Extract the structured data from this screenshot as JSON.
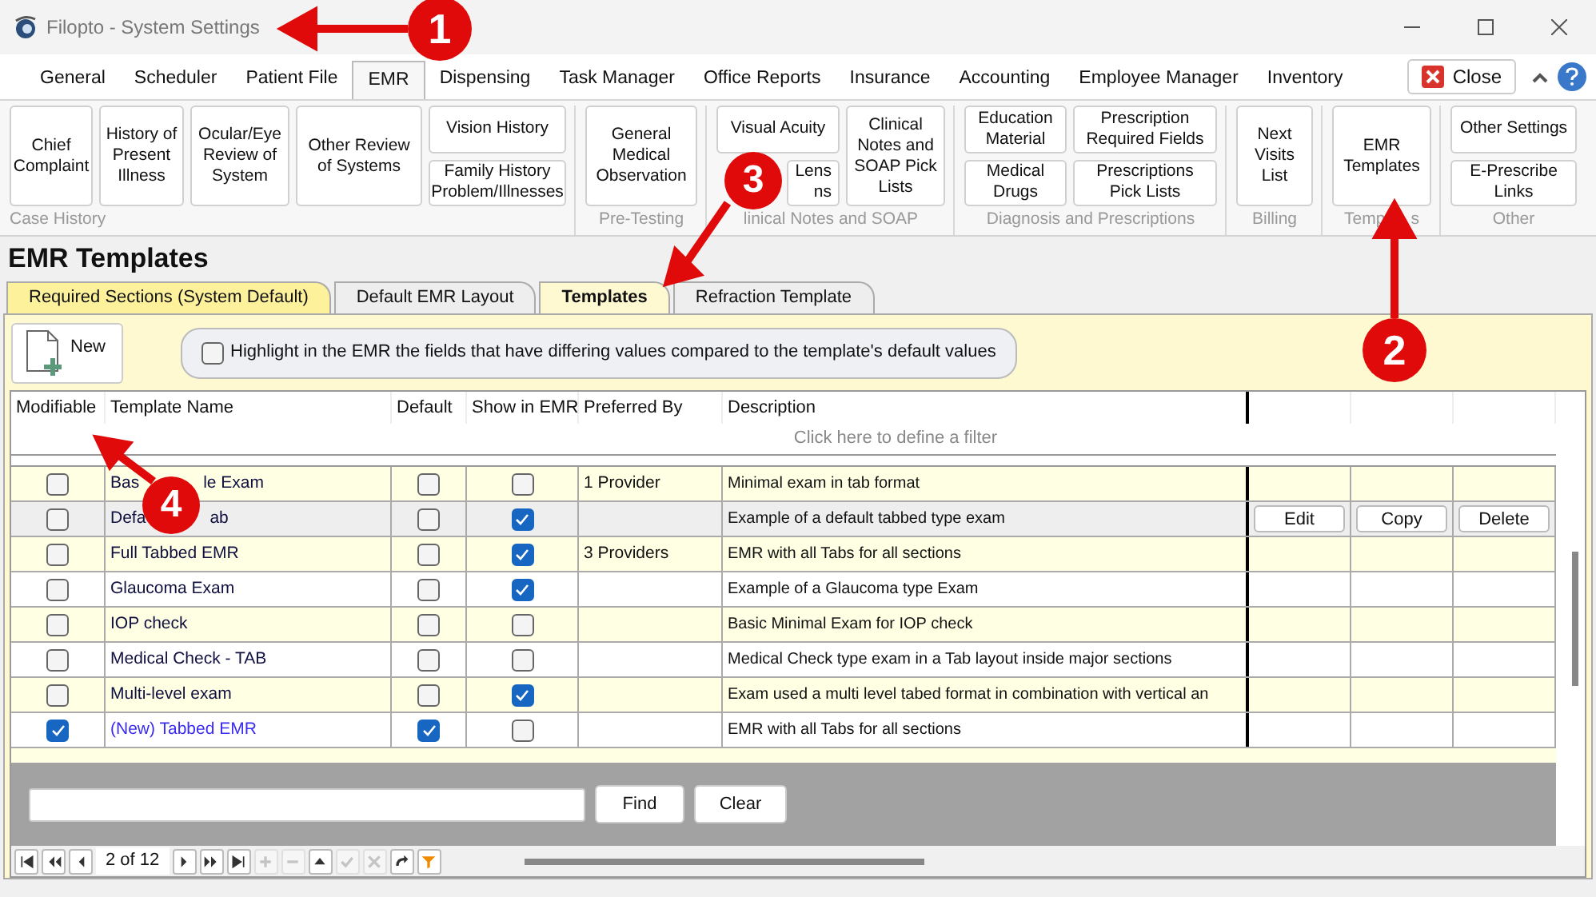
{
  "window": {
    "title": "Filopto - System Settings"
  },
  "menu_tabs": [
    {
      "label": "General",
      "selected": false
    },
    {
      "label": "Scheduler",
      "selected": false
    },
    {
      "label": "Patient File",
      "selected": false
    },
    {
      "label": "EMR",
      "selected": true
    },
    {
      "label": "Dispensing",
      "selected": false
    },
    {
      "label": "Task Manager",
      "selected": false
    },
    {
      "label": "Office Reports",
      "selected": false
    },
    {
      "label": "Insurance",
      "selected": false
    },
    {
      "label": "Accounting",
      "selected": false
    },
    {
      "label": "Employee Manager",
      "selected": false
    },
    {
      "label": "Inventory",
      "selected": false
    }
  ],
  "close_button": "Close",
  "ribbon": [
    {
      "label": [
        "Case History"
      ],
      "columns": [
        [
          {
            "lines": [
              "Chief",
              "Complaint"
            ]
          }
        ],
        [
          {
            "lines": [
              "History of",
              "Present",
              "Illness"
            ]
          }
        ],
        [
          {
            "lines": [
              "Ocular/Eye",
              "Review of",
              "System"
            ]
          }
        ],
        [
          {
            "lines": [
              "Other Review",
              "of Systems"
            ]
          }
        ],
        [
          {
            "lines": [
              "Vision History"
            ]
          },
          {
            "lines": [
              "Family History",
              "Problem/Illnesses"
            ]
          }
        ]
      ]
    },
    {
      "label": [
        "Pre-Testing"
      ],
      "columns": [
        [
          {
            "lines": [
              "General",
              "Medical",
              "Observation"
            ]
          }
        ]
      ]
    },
    {
      "label": [
        "linical Notes and SOAP"
      ],
      "columns": [
        [
          {
            "lines": [
              "Visual Acuity"
            ]
          },
          {
            "lines": [
              "Lens",
              "ns"
            ]
          }
        ],
        [
          {
            "lines": [
              "Clinical",
              "Notes and",
              "SOAP Pick",
              "Lists"
            ]
          }
        ]
      ]
    },
    {
      "label": [
        "Diagnosis and Prescriptions"
      ],
      "columns": [
        [
          {
            "lines": [
              "Education",
              "Material"
            ]
          },
          {
            "lines": [
              "Medical",
              "Drugs"
            ]
          }
        ],
        [
          {
            "lines": [
              "Prescription",
              "Required Fields"
            ]
          },
          {
            "lines": [
              "Prescriptions",
              "Pick Lists"
            ]
          }
        ]
      ]
    },
    {
      "label": [
        "Billing"
      ],
      "columns": [
        [
          {
            "lines": [
              "Next",
              "Visits",
              "List"
            ]
          }
        ]
      ]
    },
    {
      "label": [
        "Temp",
        "s"
      ],
      "columns": [
        [
          {
            "lines": [
              "EMR",
              "Templates"
            ]
          }
        ]
      ]
    },
    {
      "label": [
        "Other"
      ],
      "columns": [
        [
          {
            "lines": [
              "Other Settings"
            ]
          },
          {
            "lines": [
              "E-Prescribe",
              "Links"
            ]
          }
        ]
      ]
    }
  ],
  "page_title": "EMR Templates",
  "tabs": [
    {
      "label": "Required Sections (System Default)",
      "selected": false,
      "highlighted": true
    },
    {
      "label": "Default EMR Layout",
      "selected": false,
      "highlighted": false
    },
    {
      "label": "Templates",
      "selected": true,
      "highlighted": false
    },
    {
      "label": "Refraction Template",
      "selected": false,
      "highlighted": false
    }
  ],
  "new_button": "New",
  "highlight_option": {
    "label": "Highlight in the EMR the fields that have differing values compared to the template's default values",
    "checked": false
  },
  "table": {
    "columns": [
      "Modifiable",
      "Template Name",
      "Default",
      "Show in EMR",
      "Preferred By",
      "Description"
    ],
    "filter_hint": "Click here to define a filter",
    "rows": [
      {
        "name": [
          "Bas",
          "le Exam"
        ],
        "modifiable": false,
        "default": false,
        "show_in_emr": false,
        "preferred_by": "1 Provider",
        "description": "Minimal exam in tab format",
        "selected": false,
        "new": false
      },
      {
        "name": [
          "Defa",
          "ab"
        ],
        "modifiable": false,
        "default": false,
        "show_in_emr": true,
        "description": "Example of a default tabbed type exam",
        "selected": true,
        "new": false,
        "actions": [
          "Edit",
          "Copy",
          "Delete"
        ]
      },
      {
        "name": [
          "Full Tabbed EMR"
        ],
        "modifiable": false,
        "default": false,
        "show_in_emr": true,
        "preferred_by": "3 Providers",
        "description": "EMR with all Tabs for all sections",
        "selected": false,
        "new": false
      },
      {
        "name": [
          "Glaucoma Exam"
        ],
        "modifiable": false,
        "default": false,
        "show_in_emr": true,
        "description": "Example of a Glaucoma type Exam",
        "selected": false,
        "new": false
      },
      {
        "name": [
          "IOP check"
        ],
        "modifiable": false,
        "default": false,
        "show_in_emr": false,
        "description": "Basic Minimal Exam for IOP check",
        "selected": false,
        "new": false
      },
      {
        "name": [
          "Medical Check - TAB"
        ],
        "modifiable": false,
        "default": false,
        "show_in_emr": false,
        "description": "Medical Check type exam in a Tab layout inside major sections",
        "selected": false,
        "new": false
      },
      {
        "name": [
          "Multi-level exam"
        ],
        "modifiable": false,
        "default": false,
        "show_in_emr": true,
        "description": "Exam used a multi level tabed format in combination with vertical an",
        "selected": false,
        "new": false
      },
      {
        "name": [
          "(New) Tabbed EMR"
        ],
        "modifiable": true,
        "default": true,
        "show_in_emr": false,
        "description": "EMR with all Tabs for all sections",
        "selected": false,
        "new": true
      }
    ]
  },
  "search": {
    "find": "Find",
    "clear": "Clear"
  },
  "navigator": {
    "position": "2 of 12",
    "buttons": [
      {
        "kind": "first",
        "disabled": false
      },
      {
        "kind": "prev-page",
        "disabled": false
      },
      {
        "kind": "prev",
        "disabled": false
      },
      {
        "kind": "position"
      },
      {
        "kind": "next",
        "disabled": false
      },
      {
        "kind": "next-page",
        "disabled": false
      },
      {
        "kind": "last",
        "disabled": false
      },
      {
        "kind": "add",
        "disabled": true
      },
      {
        "kind": "remove",
        "disabled": true
      },
      {
        "kind": "up",
        "disabled": false
      },
      {
        "kind": "check",
        "disabled": true
      },
      {
        "kind": "cancel",
        "disabled": true
      },
      {
        "kind": "refresh",
        "disabled": false
      },
      {
        "kind": "filter",
        "disabled": false
      }
    ]
  },
  "callouts": [
    {
      "number": "1"
    },
    {
      "number": "2"
    },
    {
      "number": "3"
    },
    {
      "number": "4"
    }
  ]
}
